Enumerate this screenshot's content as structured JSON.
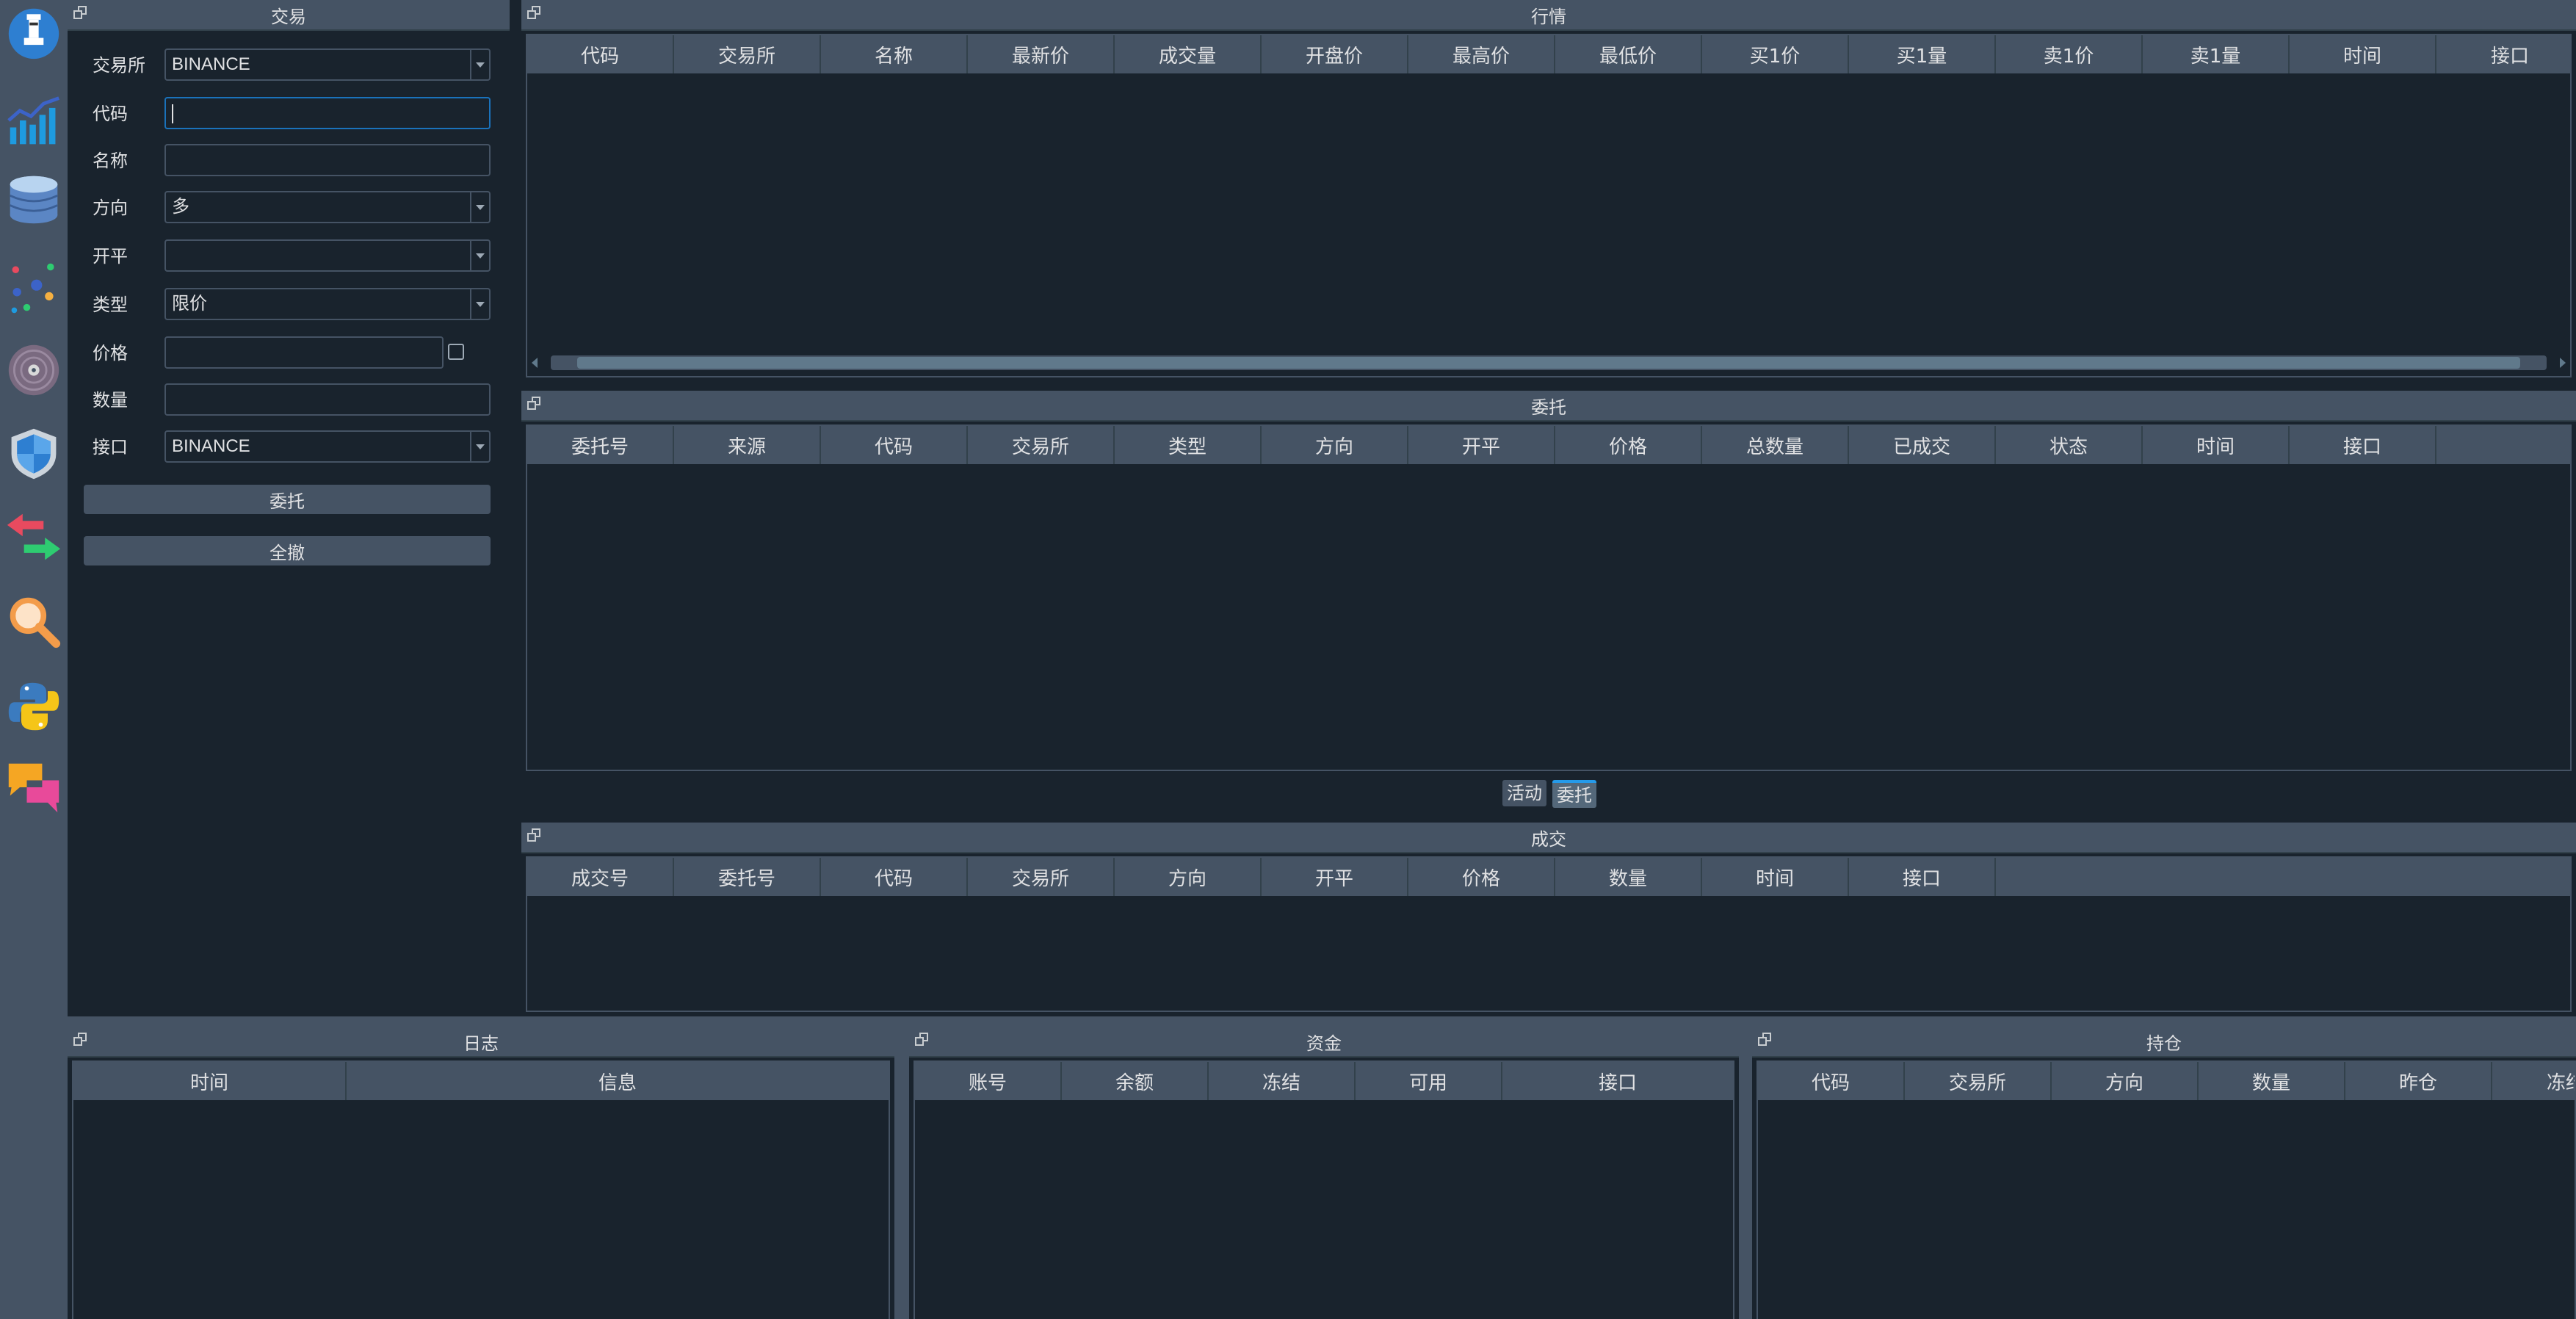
{
  "toolbar": {
    "items": [
      "trader-icon",
      "market-chart-icon",
      "database-icon",
      "scatter-dots-icon",
      "disc-icon",
      "shield-icon",
      "swap-arrows-icon",
      "search-icon",
      "python-icon",
      "chat-icon"
    ]
  },
  "trading": {
    "title": "交易",
    "labels": {
      "exchange": "交易所",
      "code": "代码",
      "name": "名称",
      "direction": "方向",
      "offset": "开平",
      "type": "类型",
      "price": "价格",
      "volume": "数量",
      "gateway": "接口"
    },
    "values": {
      "exchange": "BINANCE",
      "code": "",
      "name": "",
      "direction": "多",
      "offset": "",
      "type": "限价",
      "price": "",
      "volume": "",
      "gateway": "BINANCE"
    },
    "buttons": {
      "send": "委托",
      "cancel_all": "全撤"
    }
  },
  "tick": {
    "title": "行情",
    "columns": [
      "代码",
      "交易所",
      "名称",
      "最新价",
      "成交量",
      "开盘价",
      "最高价",
      "最低价",
      "买1价",
      "买1量",
      "卖1价",
      "卖1量",
      "时间",
      "接口"
    ]
  },
  "order": {
    "title": "委托",
    "columns": [
      "委托号",
      "来源",
      "代码",
      "交易所",
      "类型",
      "方向",
      "开平",
      "价格",
      "总数量",
      "已成交",
      "状态",
      "时间",
      "接口"
    ]
  },
  "tabs": {
    "active_tab": "活动",
    "order_tab": "委托"
  },
  "trade": {
    "title": "成交",
    "columns": [
      "成交号",
      "委托号",
      "代码",
      "交易所",
      "方向",
      "开平",
      "价格",
      "数量",
      "时间",
      "接口"
    ]
  },
  "log": {
    "title": "日志",
    "columns": [
      "时间",
      "信息"
    ]
  },
  "account": {
    "title": "资金",
    "columns": [
      "账号",
      "余额",
      "冻结",
      "可用",
      "接口"
    ]
  },
  "position": {
    "title": "持仓",
    "columns": [
      "代码",
      "交易所",
      "方向",
      "数量",
      "昨仓",
      "冻结"
    ]
  },
  "colors": {
    "background": "#19232d",
    "panel": "#455364",
    "accent": "#1a72bb"
  }
}
